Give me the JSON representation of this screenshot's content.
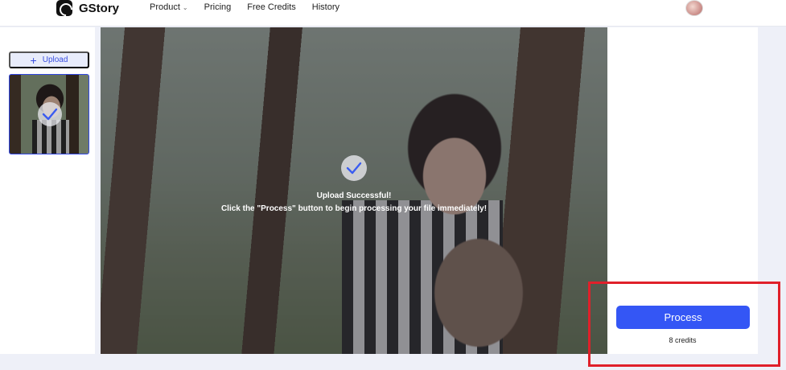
{
  "header": {
    "brand": "GStory",
    "nav": [
      {
        "label": "Product",
        "has_dropdown": true
      },
      {
        "label": "Pricing"
      },
      {
        "label": "Free Credits"
      },
      {
        "label": "History"
      }
    ]
  },
  "sidebar": {
    "upload_label": "Upload"
  },
  "main": {
    "status_title": "Upload Successful!",
    "status_message": "Click the \"Process\" button to begin processing your file immediately!"
  },
  "action_panel": {
    "process_label": "Process",
    "credits_label": "8 credits"
  },
  "colors": {
    "accent": "#3456f5",
    "highlight": "#e0202a"
  },
  "icons": [
    "logo-icon",
    "chevron-down-icon",
    "plus-icon",
    "check-icon",
    "avatar"
  ]
}
